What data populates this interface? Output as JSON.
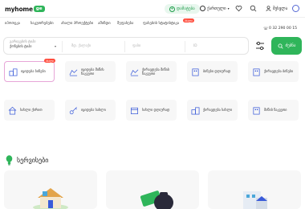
{
  "header": {
    "logo_text": "myhome",
    "logo_badge": "ge",
    "add_label": "დამატება",
    "language": "ქართული",
    "login_label": "შესვლა"
  },
  "nav": {
    "items": [
      "იპოთეკა",
      "საკუთრებები",
      "ახალი პროექტები",
      "ამინდი",
      "შეფასება",
      "ფასების სტატისტიკა"
    ],
    "badge": "ახალი",
    "phone": "0 32 290 00 15"
  },
  "search": {
    "deal_label": "გარიგების ტიპი",
    "deal_value": "ქონების ტიპი",
    "location_placeholder": "მდ. ქალაქი",
    "price_placeholder": "ფასი",
    "id_placeholder": "ID",
    "button_label": "ძებნა"
  },
  "categories": [
    {
      "label": "იყიდება ბინები",
      "badge": "ახალი",
      "icon": "building-icon"
    },
    {
      "label": "იყიდება მიწის ნაკვეთი",
      "icon": "land-icon"
    },
    {
      "label": "ქირავდება მიწის ნაკვეთი",
      "icon": "land-icon"
    },
    {
      "label": "ბინები დღიურად",
      "icon": "apartment-icon"
    },
    {
      "label": "ქირავდება ბინები",
      "icon": "apartment-icon"
    },
    {
      "label": "სახლი ქირით",
      "icon": "house-icon"
    },
    {
      "label": "იყიდება სახლი",
      "icon": "key-icon"
    },
    {
      "label": "სახლი დღიურად",
      "icon": "calendar-icon"
    },
    {
      "label": "ქირავდება სახლი",
      "icon": "building-icon"
    },
    {
      "label": "მიწის ნაკვეთი",
      "icon": "apartment-icon"
    }
  ],
  "services": {
    "title": "სერვისები"
  },
  "colors": {
    "brand": "#2fb55a",
    "badge": "#ff4d3d"
  }
}
